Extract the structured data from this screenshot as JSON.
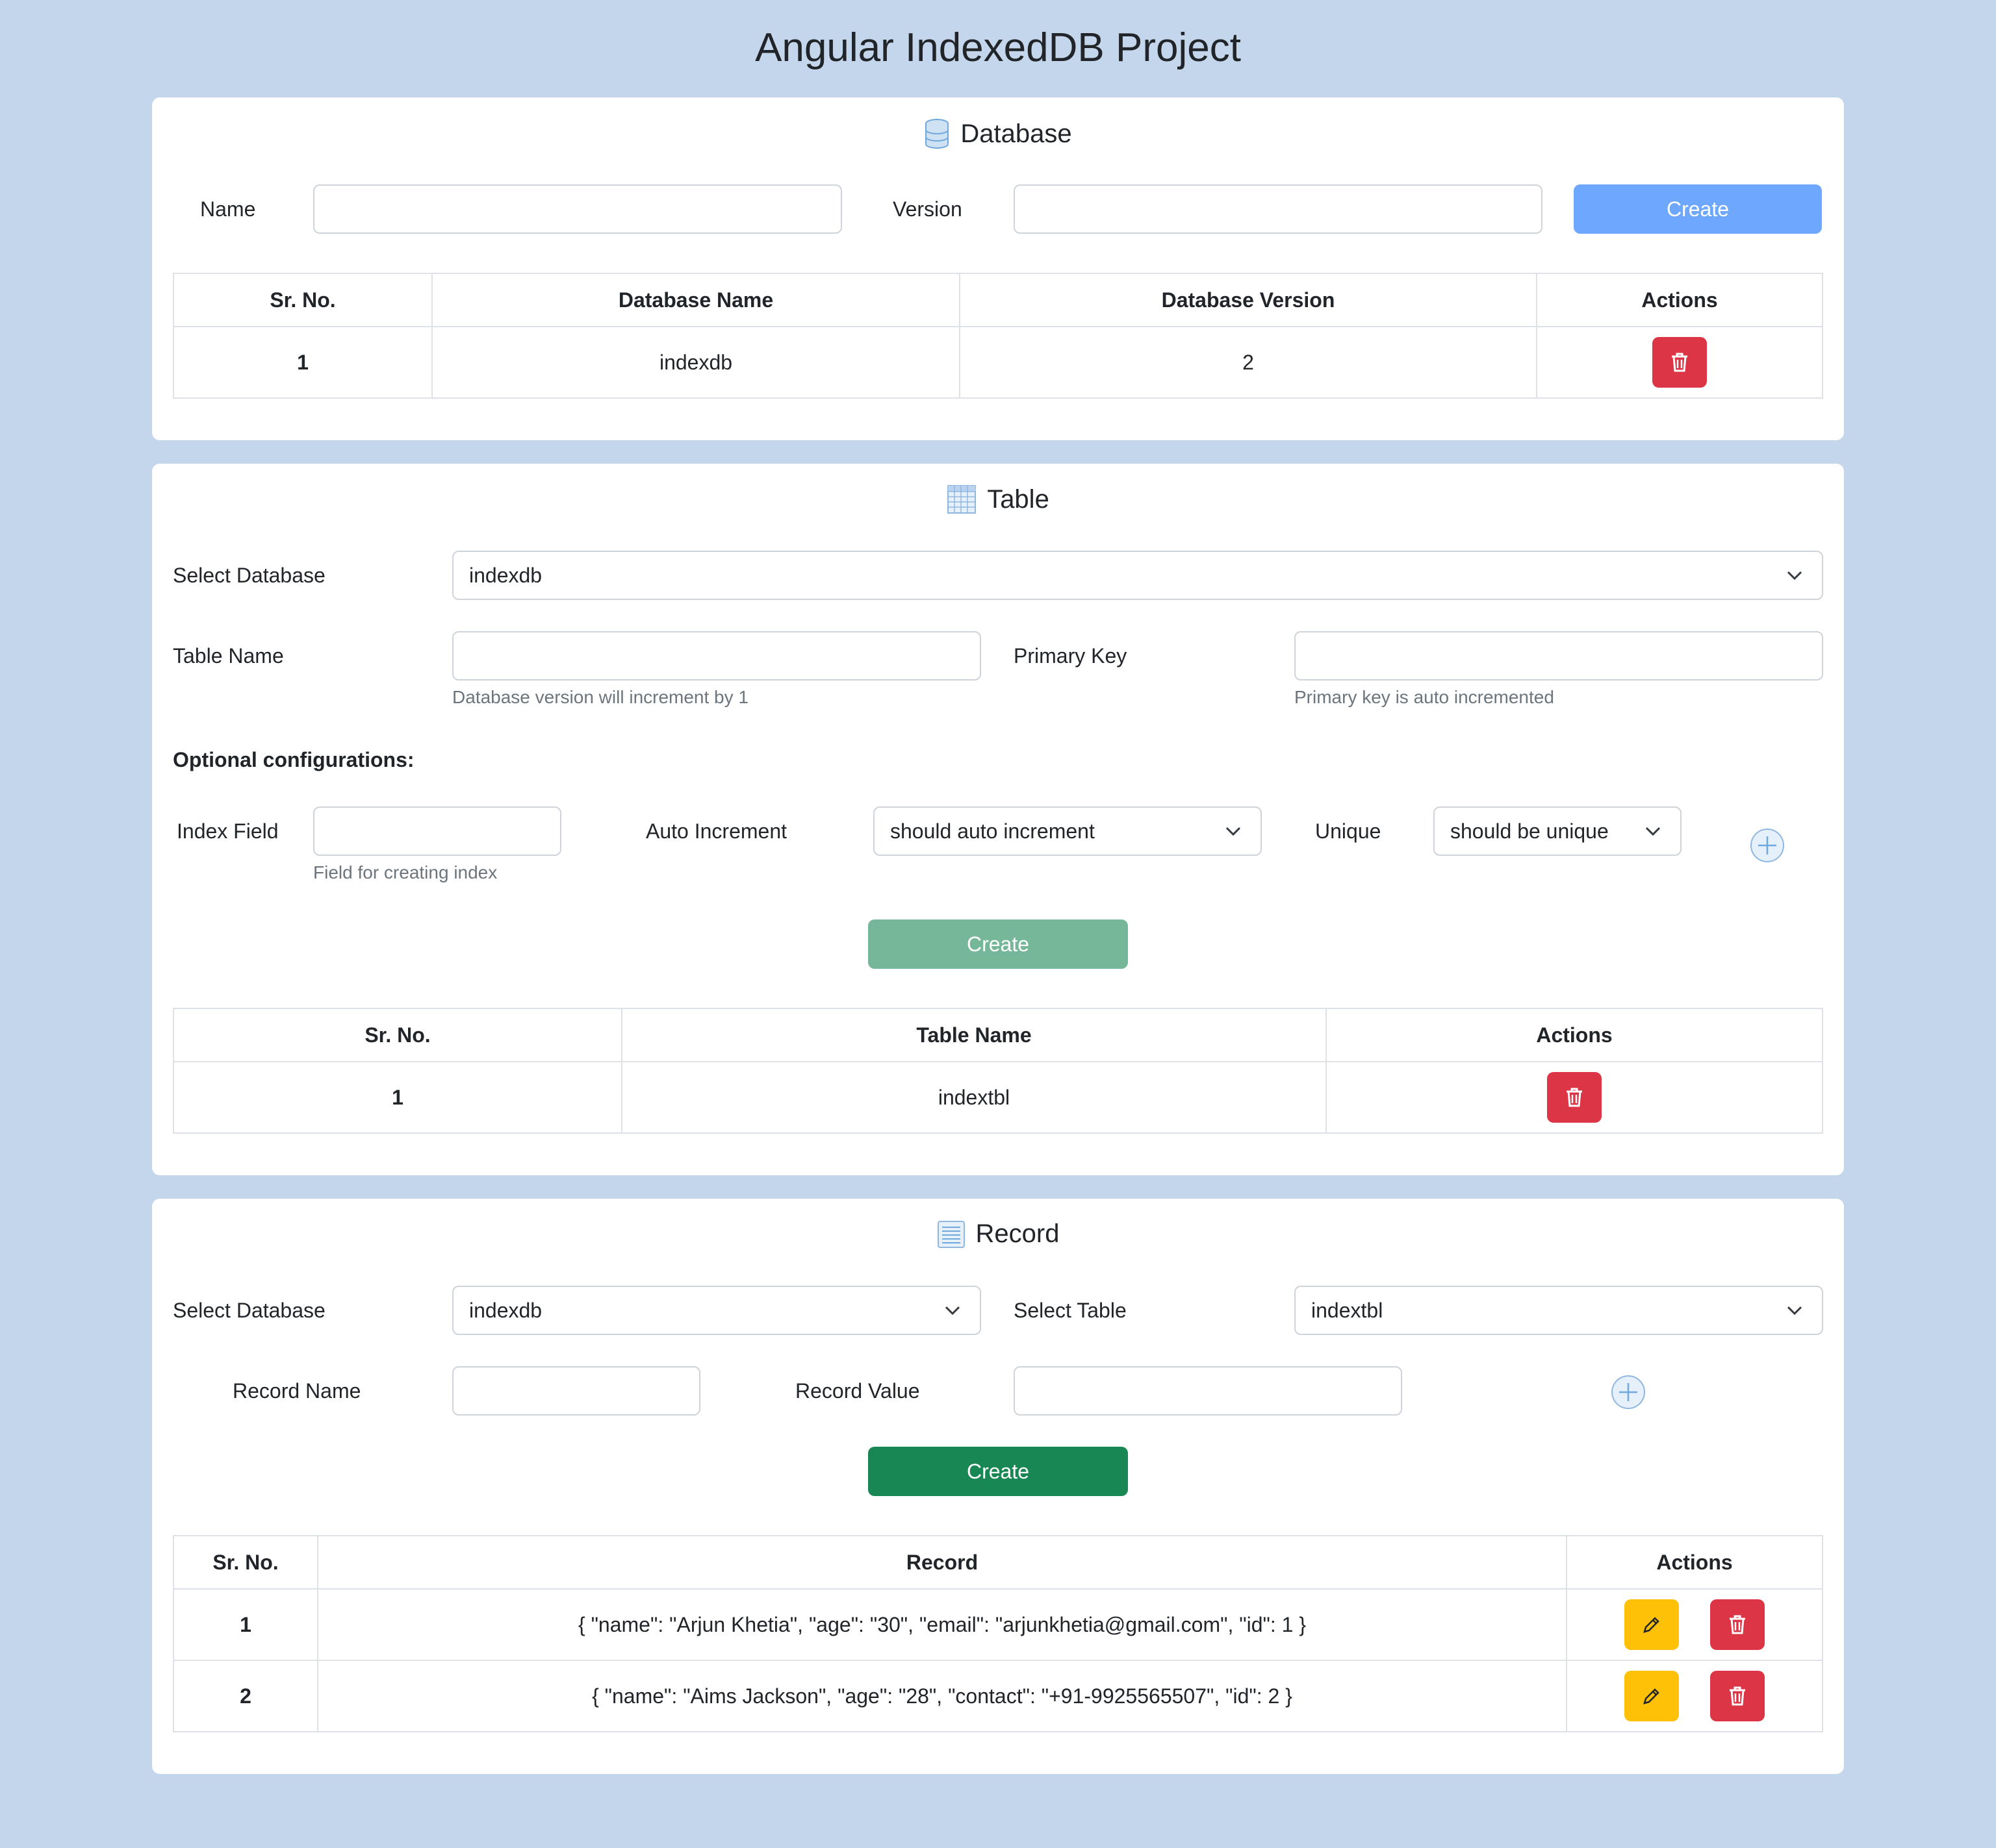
{
  "page": {
    "title": "Angular IndexedDB Project"
  },
  "database": {
    "title": "Database",
    "icon": "database-icon",
    "name_label": "Name",
    "version_label": "Version",
    "name_value": "",
    "version_value": "",
    "create_label": "Create",
    "table": {
      "headers": [
        "Sr. No.",
        "Database Name",
        "Database Version",
        "Actions"
      ],
      "rows": [
        {
          "sr": "1",
          "name": "indexdb",
          "version": "2"
        }
      ]
    }
  },
  "table_section": {
    "title": "Table",
    "icon": "table-icon",
    "select_db_label": "Select Database",
    "select_db_value": "indexdb",
    "table_name_label": "Table Name",
    "table_name_hint": "Database version will increment by 1",
    "primary_key_label": "Primary Key",
    "primary_key_hint": "Primary key is auto incremented",
    "optional_label": "Optional configurations:",
    "index_field_label": "Index Field",
    "index_field_hint": "Field for creating index",
    "auto_increment_label": "Auto Increment",
    "auto_increment_value": "should auto increment",
    "unique_label": "Unique",
    "unique_value": "should be unique",
    "create_label": "Create",
    "table": {
      "headers": [
        "Sr. No.",
        "Table Name",
        "Actions"
      ],
      "rows": [
        {
          "sr": "1",
          "name": "indextbl"
        }
      ]
    }
  },
  "record": {
    "title": "Record",
    "icon": "list-icon",
    "select_db_label": "Select Database",
    "select_db_value": "indexdb",
    "select_table_label": "Select Table",
    "select_table_value": "indextbl",
    "record_name_label": "Record Name",
    "record_value_label": "Record Value",
    "create_label": "Create",
    "table": {
      "headers": [
        "Sr. No.",
        "Record",
        "Actions"
      ],
      "rows": [
        {
          "sr": "1",
          "record": "{ \"name\": \"Arjun Khetia\", \"age\": \"30\", \"email\": \"arjunkhetia@gmail.com\", \"id\": 1 }"
        },
        {
          "sr": "2",
          "record": "{ \"name\": \"Aims Jackson\", \"age\": \"28\", \"contact\": \"+91-9925565507\", \"id\": 2 }"
        }
      ]
    }
  },
  "colors": {
    "background": "#c4d6eb",
    "primary_disabled": "#6ea8fe",
    "success_disabled": "#75b798",
    "success": "#198754",
    "danger": "#dc3545",
    "warning": "#ffc107"
  }
}
